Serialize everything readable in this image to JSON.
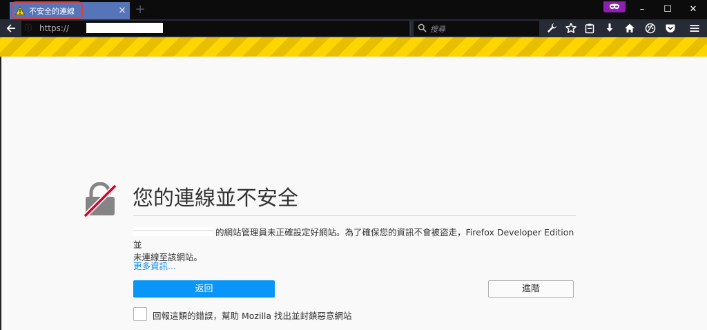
{
  "tab": {
    "title": "不安全的連線",
    "close": "×",
    "new_tab": "+"
  },
  "window": {
    "minimize": "–",
    "maximize": "☐",
    "close": "✕"
  },
  "urlbar": {
    "scheme": "https://"
  },
  "searchbar": {
    "placeholder": "搜尋"
  },
  "error_page": {
    "title": "您的連線並不安全",
    "description_line1": "的網站管理員未正確設定好網站。為了確保您的資訊不會被盜走，Firefox Developer Edition 並",
    "description_line2": "未連線至該網站。",
    "learn_more": "更多資訊...",
    "back_button": "返回",
    "advanced_button": "進階",
    "report_label": "回報這類的錯誤，幫助 Mozilla 找出並封鎖惡意網站"
  },
  "colors": {
    "tab_bg": "#5675b9",
    "chrome_bg": "#0c0c0d",
    "navbar_bg": "#272b35",
    "stripe": "#ffd500",
    "accent_blue": "#0996f8",
    "private": "#8d20ae",
    "highlight": "#e03c3c"
  },
  "icons": [
    "warning-icon",
    "back-arrow-icon",
    "reload-icon",
    "search-icon",
    "wrench-icon",
    "star-icon",
    "clipboard-icon",
    "download-icon",
    "home-icon",
    "palette-icon",
    "pocket-icon",
    "menu-icon",
    "private-mask-icon",
    "broken-lock-icon"
  ]
}
